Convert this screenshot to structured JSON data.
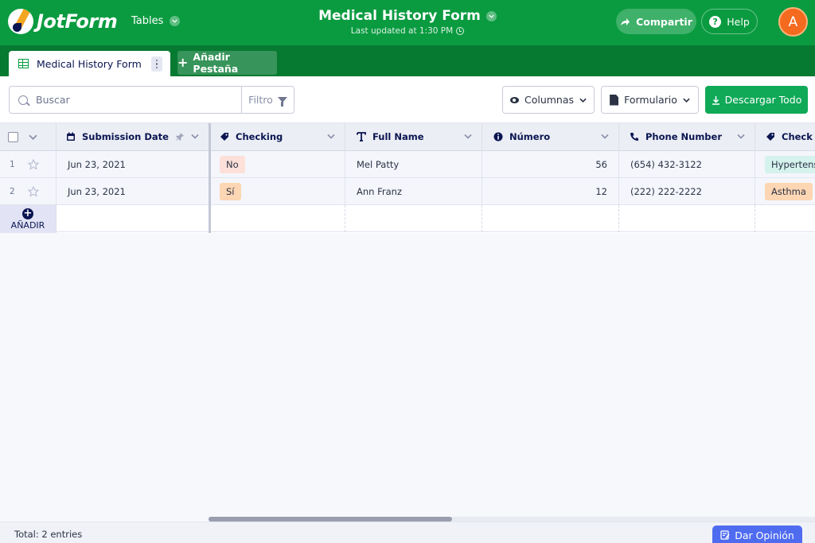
{
  "header": {
    "logo_text": "JotForm",
    "tables_label": "Tables",
    "form_title": "Medical History Form",
    "last_updated": "Last updated at 1:30 PM",
    "share_label": "Compartir",
    "help_label": "Help",
    "avatar_initial": "A"
  },
  "tabs": {
    "active_tab_label": "Medical History Form",
    "add_tab_label": "Añadir Pestaña"
  },
  "toolbar": {
    "search_placeholder": "Buscar",
    "filter_label": "Filtro",
    "columns_label": "Columnas",
    "form_label": "Formulario",
    "download_label": "Descargar Todo"
  },
  "table": {
    "columns": [
      {
        "label": "Submission Date",
        "icon": "calendar-icon"
      },
      {
        "label": "Checking",
        "icon": "tag-icon"
      },
      {
        "label": "Full Name",
        "icon": "text-icon"
      },
      {
        "label": "Número",
        "icon": "info-icon"
      },
      {
        "label": "Phone Number",
        "icon": "phone-icon"
      },
      {
        "label": "Check th",
        "icon": "tag-icon"
      }
    ],
    "rows": [
      {
        "num": "1",
        "date": "Jun 23, 2021",
        "checking": "No",
        "name": "Mel Patty",
        "numero": "56",
        "phone": "(654) 432-3122",
        "check": "Hypertens"
      },
      {
        "num": "2",
        "date": "Jun 23, 2021",
        "checking": "Sí",
        "name": "Ann Franz",
        "numero": "12",
        "phone": "(222) 222-2222",
        "check": "Asthma"
      }
    ],
    "add_row_label": "AÑADIR"
  },
  "footer": {
    "total_label": "Total: 2 entries",
    "feedback_label": "Dar Opinión"
  },
  "colors": {
    "brand_green": "#0a9b40",
    "tab_bar_green": "#067a31",
    "download_green": "#0fa958",
    "avatar_orange": "#f46a1e",
    "feedback_blue": "#4f6cf0"
  }
}
